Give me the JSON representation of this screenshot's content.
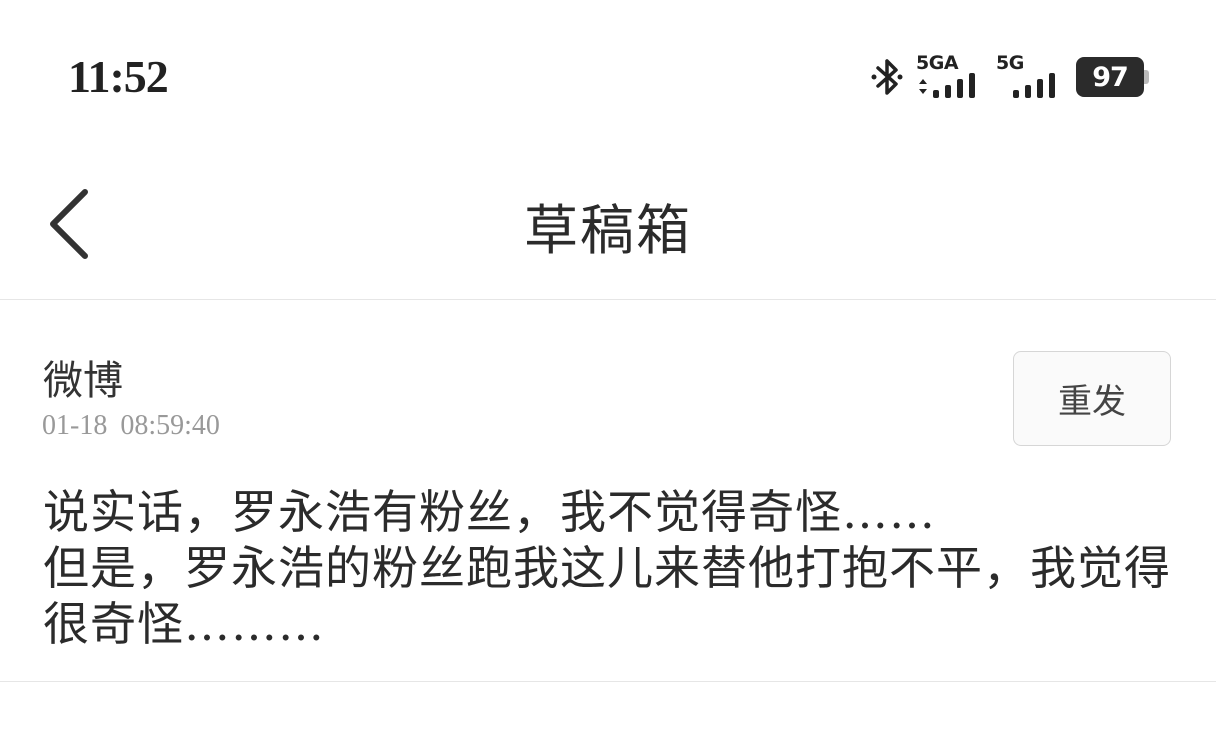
{
  "status_bar": {
    "time": "11:52",
    "signal1_label": "5GA",
    "signal2_label": "5G",
    "battery": "97",
    "icons": [
      "bluetooth-icon",
      "signal-5ga-icon",
      "signal-5g-icon",
      "battery-icon"
    ]
  },
  "header": {
    "title": "草稿箱",
    "back_icon": "chevron-left-icon"
  },
  "draft": {
    "source": "微博",
    "timestamp": "01-18  08:59:40",
    "resend_label": "重发",
    "content": "说实话，罗永浩有粉丝，我不觉得奇怪……\n但是，罗永浩的粉丝跑我这儿来替他打抱不平，我觉得很奇怪………"
  }
}
